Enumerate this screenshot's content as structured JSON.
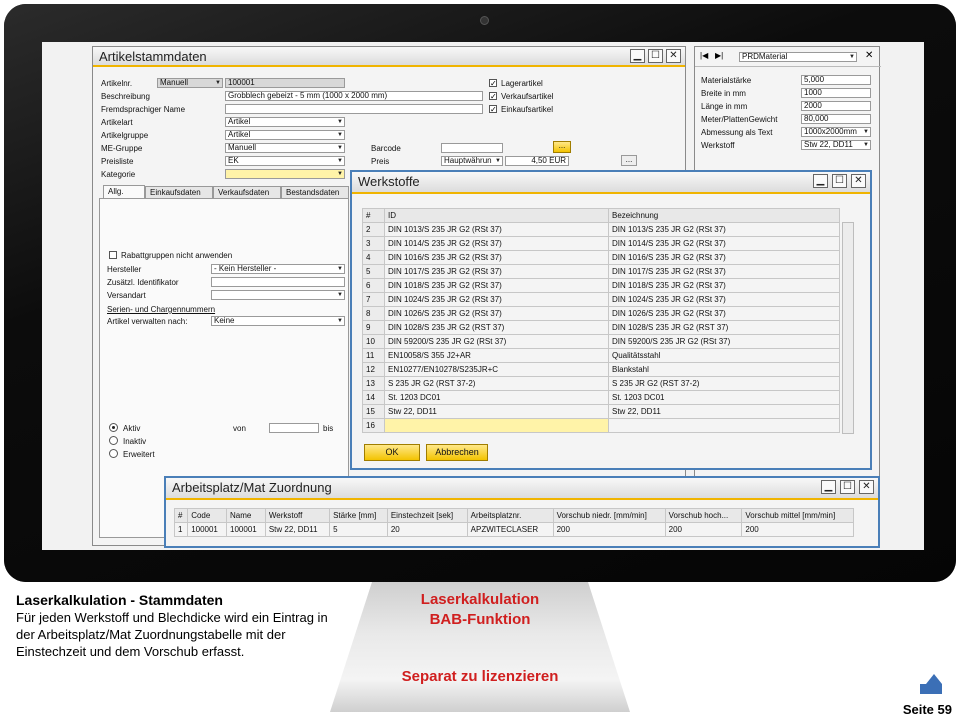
{
  "artikel": {
    "title": "Artikelstammdaten",
    "labels": {
      "artikelnr": "Artikelnr.",
      "beschreibung": "Beschreibung",
      "fremdsprachiger_name": "Fremdsprachiger Name",
      "artikelart": "Artikelart",
      "artikelgruppe": "Artikelgruppe",
      "me_gruppe": "ME-Gruppe",
      "preisliste": "Preisliste",
      "kategorie": "Kategorie",
      "barcode": "Barcode",
      "preis": "Preis"
    },
    "values": {
      "artikelnr_mode": "Manuell",
      "artikelnr": "100001",
      "beschreibung": "Grobblech gebeizt - 5 mm (1000 x 2000 mm)",
      "artikelart": "Artikel",
      "artikelgruppe": "Artikel",
      "me_gruppe": "Manuell",
      "preisliste": "EK",
      "preis_type": "Hauptwährun",
      "preis_value": "4,50 EUR"
    },
    "checkboxes": [
      "Lagerartikel",
      "Verkaufsartikel",
      "Einkaufsartikel"
    ],
    "tabs": [
      "Allg.",
      "Einkaufsdaten",
      "Verkaufsdaten",
      "Bestandsdaten"
    ],
    "rabatt_label": "Rabattgruppen nicht anwenden",
    "hersteller_label": "Hersteller",
    "hersteller_value": "- Kein Hersteller -",
    "zusaetzl_label": "Zusätzl. Identifikator",
    "versandart_label": "Versandart",
    "serien_label": "Serien- und Chargennummern",
    "verwalten_label": "Artikel verwalten nach:",
    "verwalten_value": "Keine",
    "radio": [
      "Aktiv",
      "Inaktiv",
      "Erweitert"
    ],
    "von": "von",
    "bis": "bis",
    "ellipsis": "..."
  },
  "prd": {
    "selector": "PRDMaterial",
    "rows": [
      {
        "label": "Materialstärke",
        "value": "5,000"
      },
      {
        "label": "Breite in mm",
        "value": "1000"
      },
      {
        "label": "Länge in mm",
        "value": "2000"
      },
      {
        "label": "Meter/PlattenGewicht",
        "value": "80,000"
      },
      {
        "label": "Abmessung als Text",
        "value": "1000x2000mm"
      },
      {
        "label": "Werkstoff",
        "value": "Stw 22, DD11"
      }
    ]
  },
  "werkstoffe": {
    "title": "Werkstoffe",
    "columns": [
      "#",
      "ID",
      "Bezeichnung"
    ],
    "rows": [
      [
        "2",
        "DIN 1013/S 235 JR G2 (RSt 37)",
        "DIN 1013/S 235 JR G2 (RSt 37)"
      ],
      [
        "3",
        "DIN 1014/S 235 JR G2 (RSt 37)",
        "DIN 1014/S 235 JR G2 (RSt 37)"
      ],
      [
        "4",
        "DIN 1016/S 235 JR G2 (RSt 37)",
        "DIN 1016/S 235 JR G2 (RSt 37)"
      ],
      [
        "5",
        "DIN 1017/S 235 JR G2 (RSt 37)",
        "DIN 1017/S 235 JR G2 (RSt 37)"
      ],
      [
        "6",
        "DIN 1018/S 235 JR G2 (RSt 37)",
        "DIN 1018/S 235 JR G2 (RSt 37)"
      ],
      [
        "7",
        "DIN 1024/S 235 JR G2 (RSt 37)",
        "DIN 1024/S 235 JR G2 (RSt 37)"
      ],
      [
        "8",
        "DIN 1026/S 235 JR G2 (RSt 37)",
        "DIN 1026/S 235 JR G2 (RSt 37)"
      ],
      [
        "9",
        "DIN 1028/S 235 JR G2 (RST 37)",
        "DIN 1028/S 235 JR G2 (RST 37)"
      ],
      [
        "10",
        "DIN 59200/S 235 JR G2 (RSt 37)",
        "DIN 59200/S 235 JR G2 (RSt 37)"
      ],
      [
        "11",
        "EN10058/S 355 J2+AR",
        "Qualitätsstahl"
      ],
      [
        "12",
        "EN10277/EN10278/S235JR+C",
        "Blankstahl"
      ],
      [
        "13",
        "S 235 JR G2 (RST 37-2)",
        "S 235 JR G2 (RST 37-2)"
      ],
      [
        "14",
        "St. 1203 DC01",
        "St. 1203 DC01"
      ],
      [
        "15",
        "Stw 22, DD11",
        "Stw 22, DD11"
      ],
      [
        "16",
        "",
        ""
      ]
    ],
    "ok": "OK",
    "cancel": "Abbrechen"
  },
  "arbeitsplatz": {
    "title": "Arbeitsplatz/Mat Zuordnung",
    "columns": [
      "#",
      "Code",
      "Name",
      "Werkstoff",
      "Stärke [mm]",
      "Einstechzeit [sek]",
      "Arbeitsplatznr.",
      "Vorschub niedr. [mm/min]",
      "Vorschub hoch...",
      "Vorschub mittel [mm/min]"
    ],
    "rows": [
      [
        "1",
        "100001",
        "100001",
        "Stw 22, DD11",
        "5",
        "20",
        "APZWITECLASER",
        "200",
        "200",
        "200"
      ]
    ]
  },
  "caption": {
    "title": "Laserkalkulation - Stammdaten",
    "body": "Für jeden Werkstoff und Blechdicke wird ein Eintrag in der Arbeitsplatz/Mat Zuordnungstabelle  mit der Einstechzeit und dem Vorschub erfasst."
  },
  "stand": {
    "line1": "Laserkalkulation",
    "line2": "BAB-Funktion",
    "line3": "Separat zu lizenzieren"
  },
  "page": "Seite 59",
  "colors": {
    "accent": "#f3c300",
    "highlight_border": "#4a7fb8",
    "red_text": "#d01f1f"
  }
}
